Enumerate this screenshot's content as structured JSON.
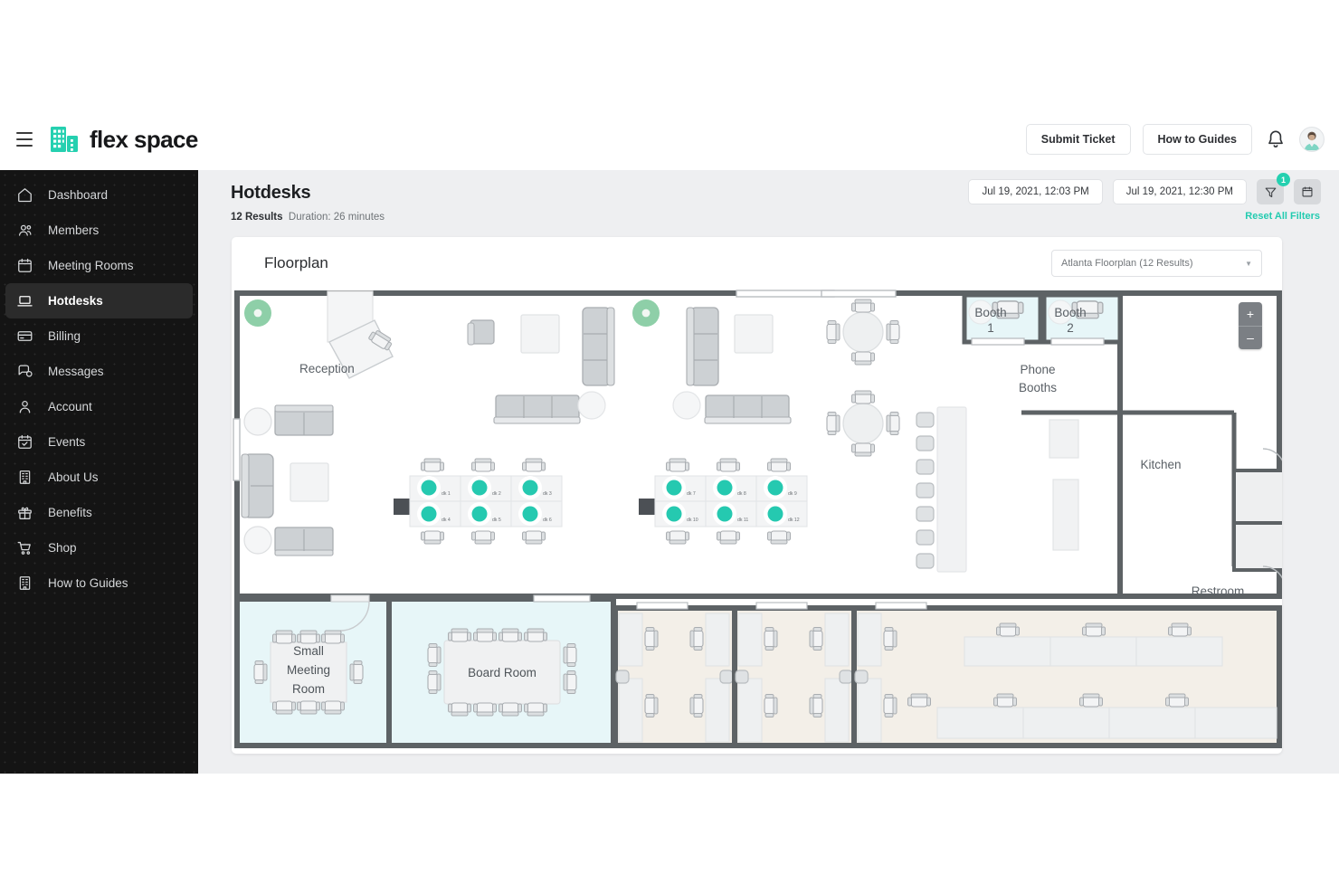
{
  "brand": {
    "name": "flex space",
    "logo_icon": "building-icon",
    "accent": "#25d0b0"
  },
  "topbar": {
    "menu_icon": "hamburger-icon",
    "submit_ticket_label": "Submit Ticket",
    "how_to_guides_label": "How to Guides",
    "bell_icon": "bell-icon",
    "avatar_icon": "user-avatar"
  },
  "sidebar": {
    "items": [
      {
        "label": "Dashboard",
        "icon": "home-icon",
        "active": false
      },
      {
        "label": "Members",
        "icon": "people-icon",
        "active": false
      },
      {
        "label": "Meeting Rooms",
        "icon": "calendar-icon",
        "active": false
      },
      {
        "label": "Hotdesks",
        "icon": "laptop-icon",
        "active": true
      },
      {
        "label": "Billing",
        "icon": "credit-card-icon",
        "active": false
      },
      {
        "label": "Messages",
        "icon": "chat-icon",
        "active": false
      },
      {
        "label": "Account",
        "icon": "person-icon",
        "active": false
      },
      {
        "label": "Events",
        "icon": "calendar-check-icon",
        "active": false
      },
      {
        "label": "About Us",
        "icon": "building-icon",
        "active": false
      },
      {
        "label": "Benefits",
        "icon": "gift-icon",
        "active": false
      },
      {
        "label": "Shop",
        "icon": "cart-icon",
        "active": false
      },
      {
        "label": "How to Guides",
        "icon": "building-icon",
        "active": false
      }
    ]
  },
  "page": {
    "title": "Hotdesks",
    "results_count": "12 Results",
    "duration": "Duration: 26 minutes",
    "start_datetime": "Jul 19, 2021, 12:03 PM",
    "end_datetime": "Jul 19, 2021, 12:30 PM",
    "filter_icon": "filter-icon",
    "filter_badge": "1",
    "calendar_icon": "calendar-icon",
    "reset_filters_label": "Reset All Filters"
  },
  "floorplan": {
    "card_title": "Floorplan",
    "selected_plan": "Atlanta Floorplan (12 Results)",
    "dropdown_caret": "chevron-down-icon",
    "zoom_in_label": "+",
    "zoom_out_label": "–",
    "labels": {
      "reception": "Reception",
      "phone_booths": "Phone Booths",
      "phone_booths_line1": "Phone",
      "phone_booths_line2": "Booths",
      "kitchen": "Kitchen",
      "restroom": "Restroom",
      "booth_1_line1": "Booth",
      "booth_1_line2": "1",
      "booth_2_line1": "Booth",
      "booth_2_line2": "2",
      "small_meeting_line1": "Small",
      "small_meeting_line2": "Meeting",
      "small_meeting_line3": "Room",
      "board_room": "Board Room"
    },
    "desks": [
      {
        "id": "dk 1"
      },
      {
        "id": "dk 2"
      },
      {
        "id": "dk 3"
      },
      {
        "id": "dk 4"
      },
      {
        "id": "dk 5"
      },
      {
        "id": "dk 6"
      },
      {
        "id": "dk 7"
      },
      {
        "id": "dk 8"
      },
      {
        "id": "dk 9"
      },
      {
        "id": "dk 10"
      },
      {
        "id": "dk 11"
      },
      {
        "id": "dk 12"
      }
    ],
    "desk_marker_color": "#25c9b0",
    "available_marker_color": "#8ecfa8",
    "room_fill_meeting": "#e7f6f8",
    "room_fill_office": "#f3efe8"
  }
}
